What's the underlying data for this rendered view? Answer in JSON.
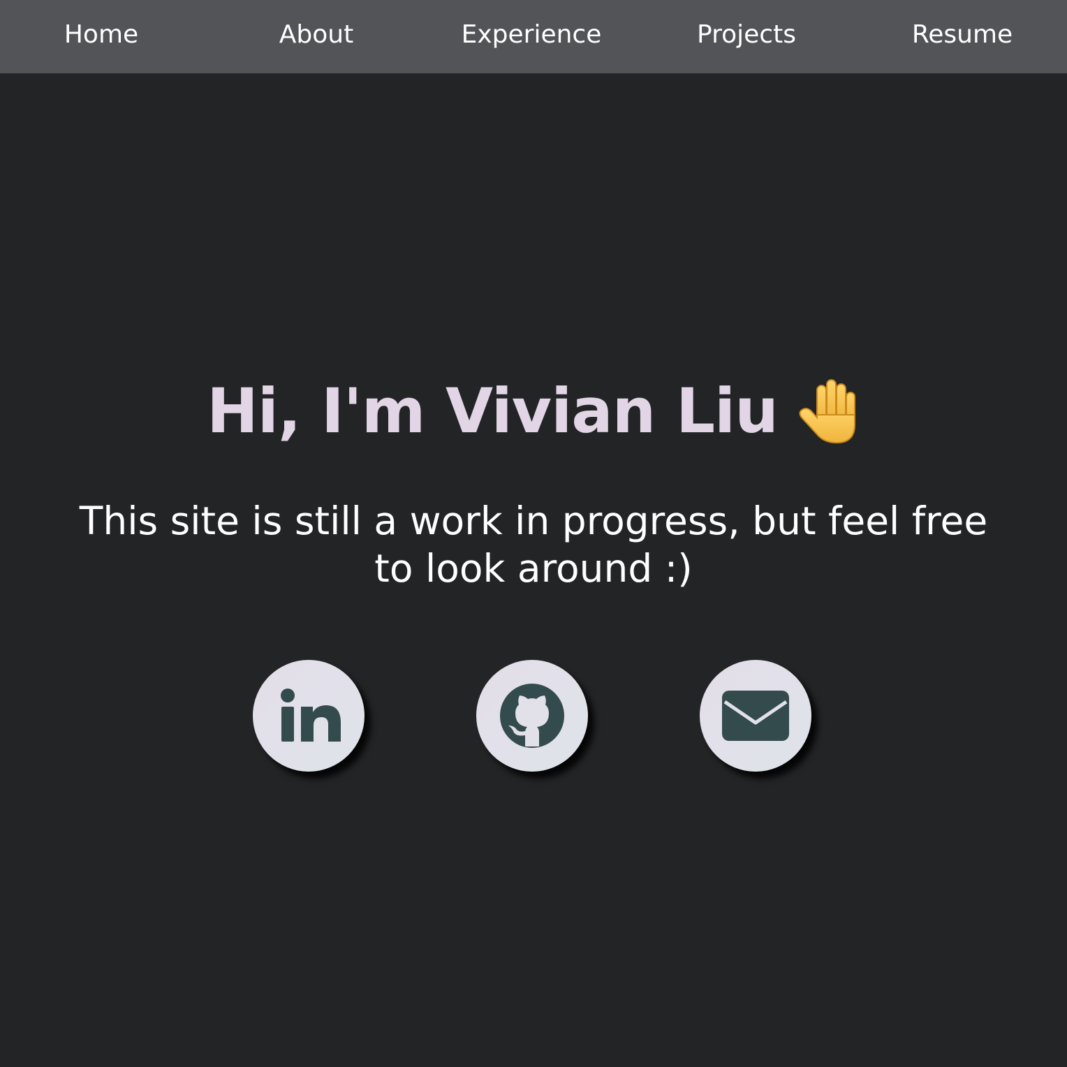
{
  "nav": {
    "items": [
      {
        "label": "Home"
      },
      {
        "label": "About"
      },
      {
        "label": "Experience"
      },
      {
        "label": "Projects"
      },
      {
        "label": "Resume"
      }
    ]
  },
  "hero": {
    "title": "Hi, I'm Vivian Liu",
    "title_icon": "raised-hand-icon",
    "subtitle": "This site is still a work in progress, but feel free to look around :)"
  },
  "social": {
    "icons": [
      "linkedin-icon",
      "github-icon",
      "email-icon"
    ]
  },
  "colors": {
    "background": "#232426",
    "navbar": "#525458",
    "title": "#e1d5e6",
    "icon_fill": "#344b4d",
    "button_bg": "#e2e1ea"
  }
}
